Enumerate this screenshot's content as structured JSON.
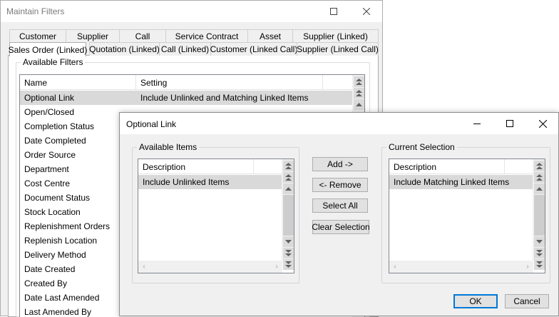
{
  "main_window": {
    "title": "Maintain Filters",
    "tabs_row1": [
      "Customer",
      "Supplier",
      "Call",
      "Service Contract",
      "Asset",
      "Supplier (Linked)"
    ],
    "tabs_row2": [
      "Sales Order (Linked)",
      "Quotation (Linked)",
      "Call (Linked)",
      "Customer (Linked Call)",
      "Supplier (Linked Call)"
    ],
    "active_tab": "Sales Order (Linked)",
    "group_label": "Available Filters",
    "columns": [
      "Name",
      "Setting"
    ],
    "selected_row": {
      "name": "Optional Link",
      "setting": "Include Unlinked and Matching Linked Items"
    },
    "filters": [
      "Open/Closed",
      "Completion Status",
      "Date Completed",
      "Order Source",
      "Department",
      "Cost Centre",
      "Document Status",
      "Stock Location",
      "Replenishment Orders",
      "Replenish Location",
      "Delivery Method",
      "Date Created",
      "Created By",
      "Date Last Amended",
      "Last Amended By"
    ]
  },
  "dialog": {
    "title": "Optional Link",
    "available": {
      "label": "Available Items",
      "column": "Description",
      "items": [
        "Include Unlinked Items"
      ]
    },
    "current": {
      "label": "Current Selection",
      "column": "Description",
      "items": [
        "Include Matching Linked Items"
      ]
    },
    "buttons": {
      "add": "Add ->",
      "remove": "<- Remove",
      "select_all": "Select All",
      "clear": "Clear Selection",
      "ok": "OK",
      "cancel": "Cancel"
    }
  },
  "icons": {
    "minimize": "minimize-icon",
    "maximize": "maximize-icon",
    "close": "close-icon",
    "scroll_up": "arrow-up-icon",
    "scroll_top": "double-arrow-up-icon",
    "scroll_down": "arrow-down-icon",
    "scroll_bottom": "double-arrow-down-icon",
    "scroll_left": "arrow-left-icon",
    "scroll_right": "arrow-right-icon"
  },
  "colors": {
    "selection": "#d9d9d9",
    "window_bg": "#f0f0f0",
    "default_button_border": "#0078d7"
  }
}
